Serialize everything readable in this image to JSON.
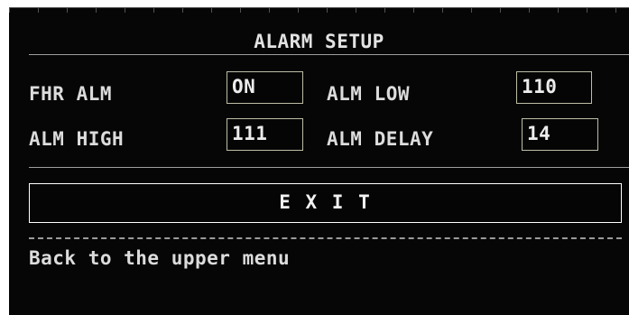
{
  "window": {
    "title": "ALARM SETUP"
  },
  "form": {
    "fields": [
      {
        "label": "FHR ALM",
        "value": "ON"
      },
      {
        "label": "ALM LOW",
        "value": "110"
      },
      {
        "label": "ALM HIGH",
        "value": "111"
      },
      {
        "label": "ALM DELAY",
        "value": "14"
      }
    ]
  },
  "actions": {
    "exit_label": "E X I T"
  },
  "status": {
    "message": "Back to the upper menu"
  }
}
